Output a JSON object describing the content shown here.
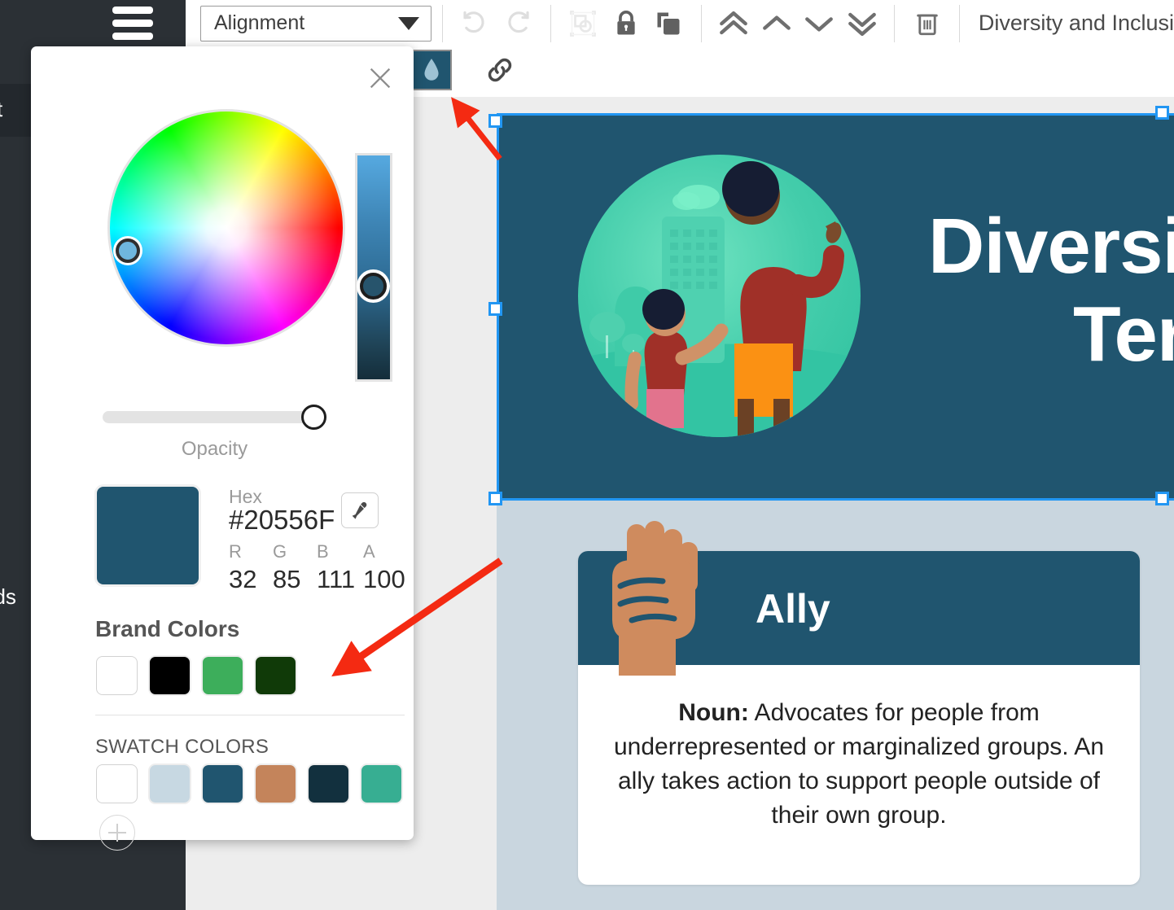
{
  "sidebar": {
    "hamburger_icon": "hamburger-menu-icon",
    "partial_item_top": "it",
    "partial_item_bottom": "ads"
  },
  "toolbar": {
    "alignment_select_value": "Alignment",
    "caret_icon": "chevron-down-icon",
    "undo_icon": "undo-icon",
    "redo_icon": "redo-icon",
    "group_icon": "group-objects-icon",
    "lock_icon": "lock-icon",
    "duplicate_icon": "duplicate-icon",
    "bring_front_icon": "bring-to-front-icon",
    "bring_forward_icon": "bring-forward-icon",
    "send_backward_icon": "send-backward-icon",
    "send_back_icon": "send-to-back-icon",
    "delete_icon": "trash-icon",
    "document_title": "Diversity and Inclusi"
  },
  "toolbar2": {
    "fill_color_icon": "droplet-icon",
    "fill_color_value": "#20556F",
    "link_icon": "link-icon"
  },
  "picker": {
    "close_icon": "close-icon",
    "wheel_icon": "color-wheel",
    "brightness_slider": "brightness-slider",
    "opacity_label": "Opacity",
    "opacity_value": 100,
    "hex_label": "Hex",
    "hex_value": "#20556F",
    "eyedropper_icon": "eyedropper-icon",
    "channels": [
      {
        "key": "R",
        "value": "32"
      },
      {
        "key": "G",
        "value": "85"
      },
      {
        "key": "B",
        "value": "111"
      },
      {
        "key": "A",
        "value": "100"
      }
    ],
    "brand_colors_title": "Brand Colors",
    "brand_colors": [
      "#FFFFFF",
      "#000000",
      "#3DAE5B",
      "#103A08"
    ],
    "swatch_colors_title": "SWATCH COLORS",
    "swatch_colors": [
      "#FFFFFF",
      "#C7D8E2",
      "#20556F",
      "#C4845B",
      "#12303E",
      "#37AE92"
    ],
    "add_swatch_icon": "plus-icon"
  },
  "canvas": {
    "background_color": "#C9D6DF",
    "banner": {
      "background_color": "#20556F",
      "title_line1": "Diversi",
      "title_line2": "Ter",
      "illustration": "adult-and-child-city-illustration",
      "selected": true
    },
    "ally_card": {
      "icon": "raised-fist-icon",
      "header_color": "#20556F",
      "title": "Ally",
      "body_bold": "Noun:",
      "body_text": " Advocates for people from underrepresented or marginalized groups. An ally takes action to support people outside of their own group."
    }
  },
  "annotations": {
    "arrow_color": "#F42A12",
    "arrow_to_droplet": "arrow-pointing-to-fill-color-button",
    "arrow_to_swatches": "arrow-pointing-to-swatch-colors"
  }
}
